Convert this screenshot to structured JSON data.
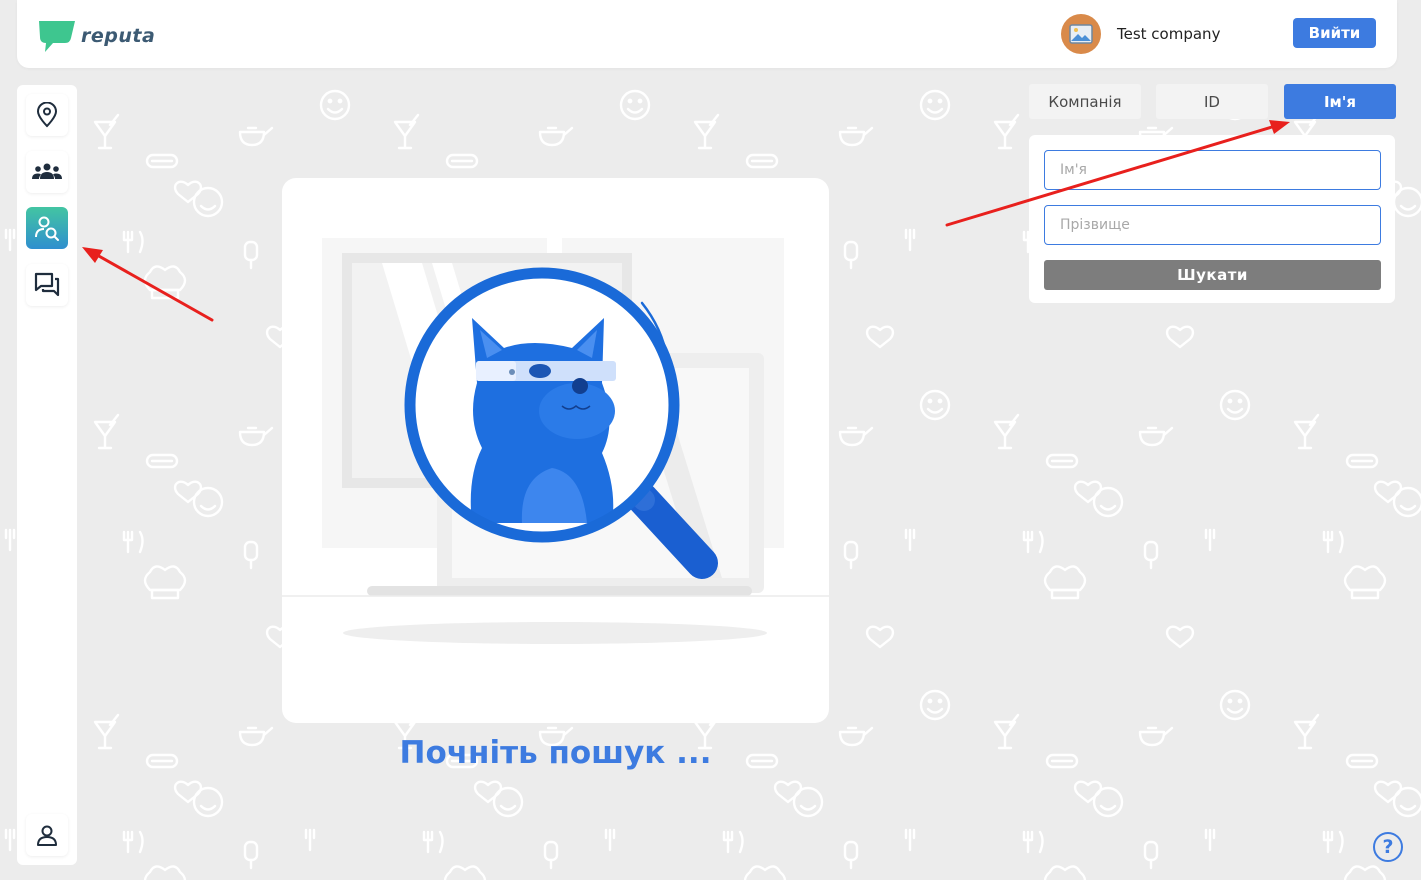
{
  "header": {
    "logo_text": "reputa",
    "company_name": "Test company",
    "logout_label": "Вийти"
  },
  "sidebar": {
    "items": [
      {
        "icon": "location-pin-icon",
        "active": false
      },
      {
        "icon": "users-group-icon",
        "active": false
      },
      {
        "icon": "user-search-icon",
        "active": true
      },
      {
        "icon": "chat-bubbles-icon",
        "active": false
      }
    ],
    "bottom_icon": "user-profile-icon"
  },
  "search_tabs": [
    {
      "label": "Компанія",
      "active": false
    },
    {
      "label": "ID",
      "active": false
    },
    {
      "label": "Ім'я",
      "active": true
    }
  ],
  "search_form": {
    "first_name_placeholder": "Ім'я",
    "last_name_placeholder": "Прізвище",
    "submit_label": "Шукати"
  },
  "main": {
    "start_text": "Почніть пошук ..."
  },
  "help": {
    "label": "?"
  },
  "colors": {
    "accent": "#3d7be0",
    "background": "#ececec",
    "annotation_arrow": "#e8201d",
    "logo_green": "#3ec68f"
  }
}
